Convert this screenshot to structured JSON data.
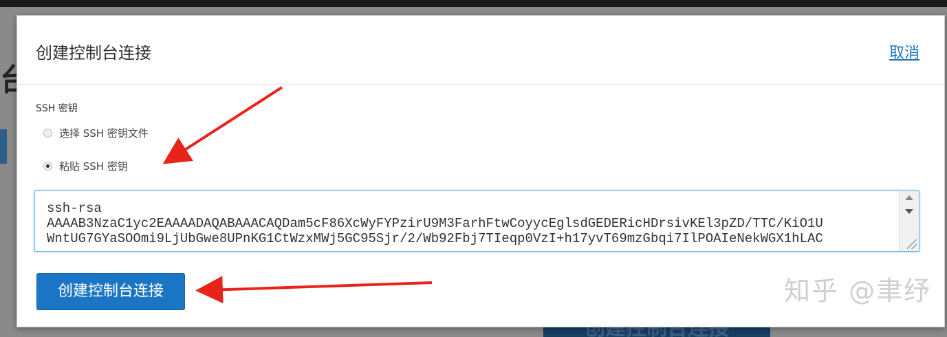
{
  "background": {
    "partial_heading_letter": "台",
    "partial_button_label": "创建控制台连接"
  },
  "dialog": {
    "title": "创建控制台连接",
    "cancel_label": "取消",
    "ssh_key_label": "SSH 密钥",
    "radio_options": [
      {
        "label": "选择 SSH 密钥文件",
        "checked": false
      },
      {
        "label": "粘贴 SSH 密钥",
        "checked": true
      }
    ],
    "key_value": "ssh-rsa\nAAAAB3NzaC1yc2EAAAADAQABAAACAQDam5cF86XcWyFYPzirU9M3FarhFtwCoyycEglsdGEDERicHDrsivKEl3pZD/TTC/KiO1U\nWntUG7GYaSOOmi9LjUbGwe8UPnKG1CtWzxMWj5GC95Sjr/2/Wb92Fbj7TIeqp0VzI+h17yvT69mzGbqi7IlPOAIeNekWGX1hLAC",
    "create_button_label": "创建控制台连接"
  },
  "watermark": "知乎 @聿纾",
  "colors": {
    "accent": "#1a75c4",
    "arrow": "#e8231a"
  }
}
